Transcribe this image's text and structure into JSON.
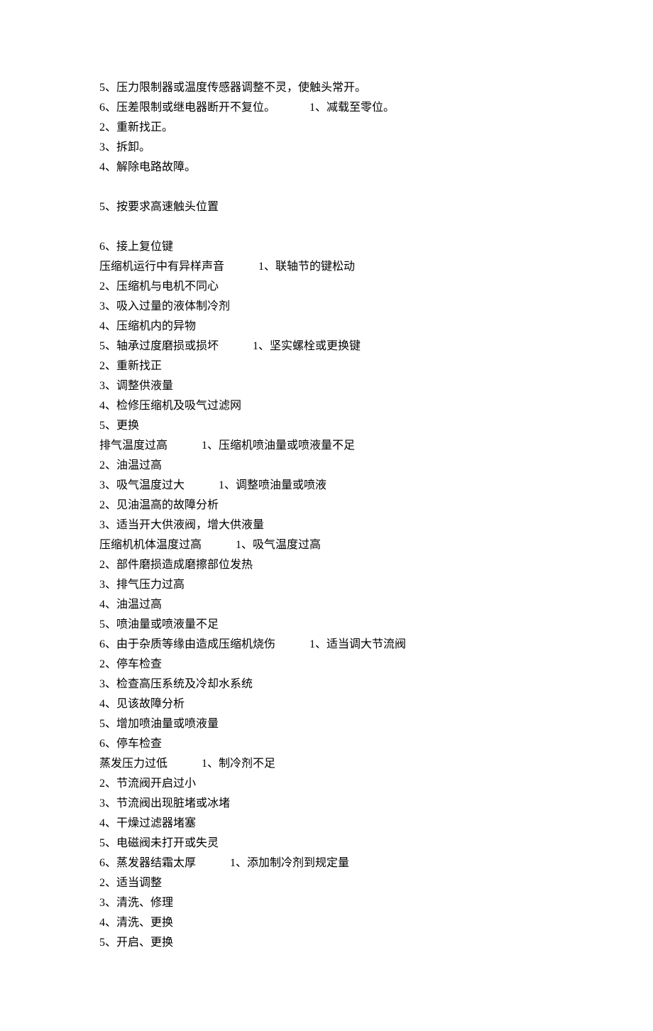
{
  "lines": [
    "5、压力限制器或温度传感器调整不灵，使触头常开。",
    "6、压差限制或继电器断开不复位。            1、减载至零位。",
    "2、重新找正。",
    "3、拆卸。",
    "4、解除电路故障。",
    "",
    "5、按要求高速触头位置",
    "",
    "6、接上复位键",
    "压缩机运行中有异样声音            1、联轴节的键松动",
    "2、压缩机与电机不同心",
    "3、吸入过量的液体制冷剂",
    "4、压缩机内的异物",
    "5、轴承过度磨损或损坏            1、坚实螺栓或更换键",
    "2、重新找正",
    "3、调整供液量",
    "4、检修压缩机及吸气过滤网",
    "5、更换",
    "排气温度过高            1、压缩机喷油量或喷液量不足",
    "2、油温过高",
    "3、吸气温度过大            1、调整喷油量或喷液",
    "2、见油温高的故障分析",
    "3、适当开大供液阀，增大供液量",
    "压缩机机体温度过高            1、吸气温度过高",
    "2、部件磨损造成磨擦部位发热",
    "3、排气压力过高",
    "4、油温过高",
    "5、喷油量或喷液量不足",
    "6、由于杂质等缘由造成压缩机烧伤            1、适当调大节流阀",
    "2、停车检查",
    "3、检查高压系统及冷却水系统",
    "4、见该故障分析",
    "5、增加喷油量或喷液量",
    "6、停车检查",
    "蒸发压力过低            1、制冷剂不足",
    "2、节流阀开启过小",
    "3、节流阀出现脏堵或冰堵",
    "4、干燥过滤器堵塞",
    "5、电磁阀未打开或失灵",
    "6、蒸发器结霜太厚            1、添加制冷剂到规定量",
    "2、适当调整",
    "3、清洗、修理",
    "4、清洗、更换",
    "5、开启、更换"
  ]
}
